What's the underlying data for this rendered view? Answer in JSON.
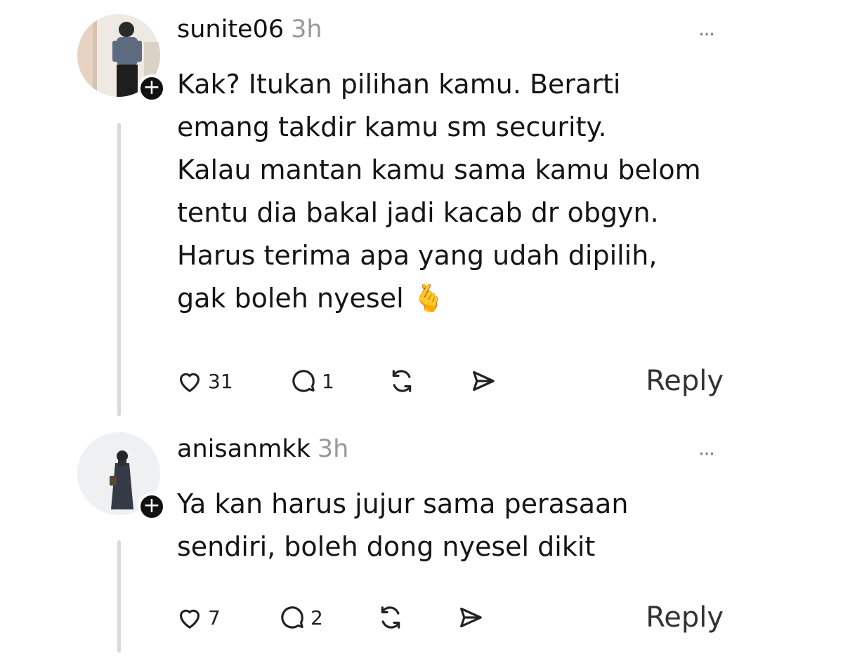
{
  "comments": [
    {
      "username": "sunite06",
      "time": "3h",
      "text": "Kak? Itukan pilihan kamu. Berarti\nemang takdir kamu sm security.\nKalau mantan kamu sama kamu belom\ntentu dia bakal jadi kacab dr obgyn.\nHarus terima apa yang udah dipilih,\ngak boleh nyesel 🫰",
      "likes": "31",
      "replies": "1",
      "more": "···",
      "reply_label": "Reply",
      "follow_symbol": "+"
    },
    {
      "username": "anisanmkk",
      "time": "3h",
      "text": "Ya kan harus jujur sama perasaan\nsendiri, boleh dong nyesel dikit",
      "likes": "7",
      "replies": "2",
      "more": "···",
      "reply_label": "Reply",
      "follow_symbol": "+"
    }
  ],
  "icons": {
    "like": "heart-icon",
    "comment": "comment-bubble-icon",
    "repost": "repost-icon",
    "share": "send-icon",
    "more": "more-icon"
  },
  "colors": {
    "text": "#111111",
    "muted": "#999999",
    "thread_line": "#d9d9d9"
  }
}
